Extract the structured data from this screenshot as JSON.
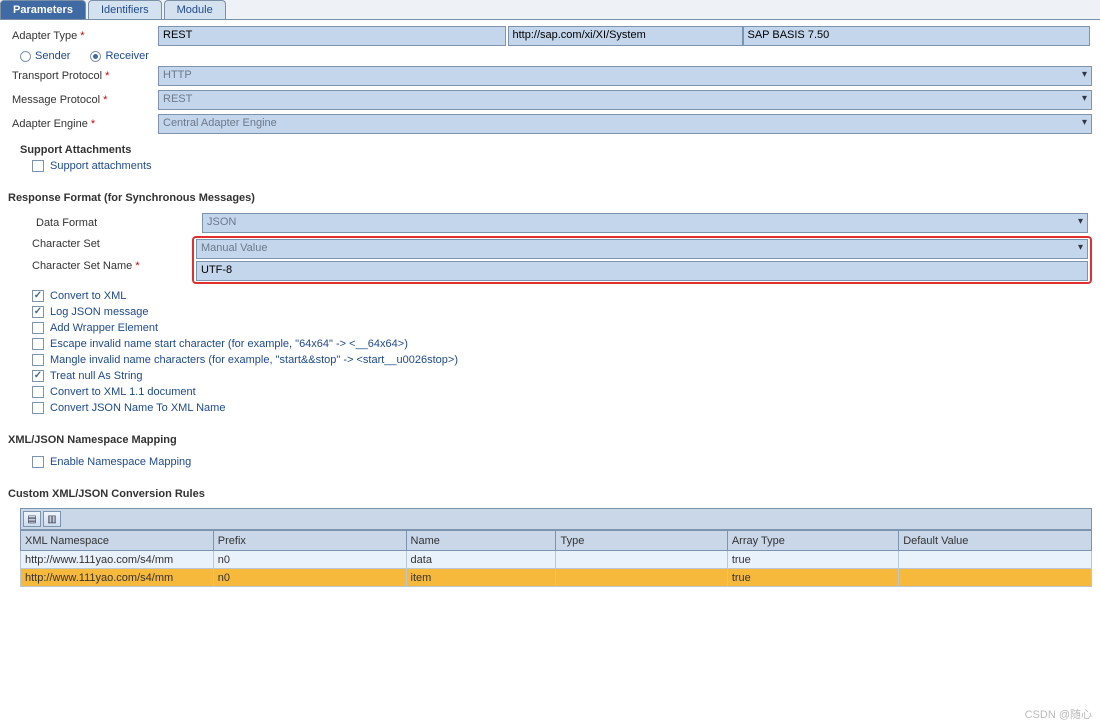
{
  "tabs": {
    "parameters": "Parameters",
    "identifiers": "Identifiers",
    "module": "Module"
  },
  "top": {
    "adapterTypeLabel": "Adapter Type",
    "adapterType": "REST",
    "adapterNs": "http://sap.com/xi/XI/System",
    "adapterVer": "SAP BASIS 7.50",
    "sender": "Sender",
    "receiver": "Receiver",
    "transportLabel": "Transport Protocol",
    "transport": "HTTP",
    "messageLabel": "Message Protocol",
    "message": "REST",
    "engineLabel": "Adapter Engine",
    "engine": "Central Adapter Engine"
  },
  "support": {
    "title": "Support Attachments",
    "attach": "Support attachments"
  },
  "resp": {
    "title": "Response Format (for Synchronous Messages)",
    "dataFormatLabel": "Data Format",
    "dataFormat": "JSON",
    "charSetLabel": "Character Set",
    "charSet": "Manual Value",
    "charSetNameLabel": "Character Set Name",
    "charSetName": "UTF-8",
    "c1": "Convert to XML",
    "c2": "Log JSON message",
    "c3": "Add Wrapper Element",
    "c4": "Escape invalid name start character (for example, \"64x64\" -> <__64x64>)",
    "c5": "Mangle invalid name characters (for example, \"start&&stop\" -> <start__u0026stop>)",
    "c6": "Treat null As String",
    "c7": "Convert to XML 1.1 document",
    "c8": "Convert JSON Name To XML Name"
  },
  "ns": {
    "title": "XML/JSON Namespace Mapping",
    "enable": "Enable Namespace Mapping"
  },
  "rules": {
    "title": "Custom XML/JSON Conversion Rules",
    "cols": {
      "ns": "XML Namespace",
      "prefix": "Prefix",
      "name": "Name",
      "type": "Type",
      "arrType": "Array Type",
      "def": "Default Value"
    },
    "rows": [
      {
        "ns": "http://www.111yao.com/s4/mm",
        "prefix": "n0",
        "name": "data",
        "type": "",
        "arr": "true",
        "def": ""
      },
      {
        "ns": "http://www.111yao.com/s4/mm",
        "prefix": "n0",
        "name": "item",
        "type": "",
        "arr": "true",
        "def": ""
      }
    ]
  },
  "watermark": "CSDN @随心"
}
